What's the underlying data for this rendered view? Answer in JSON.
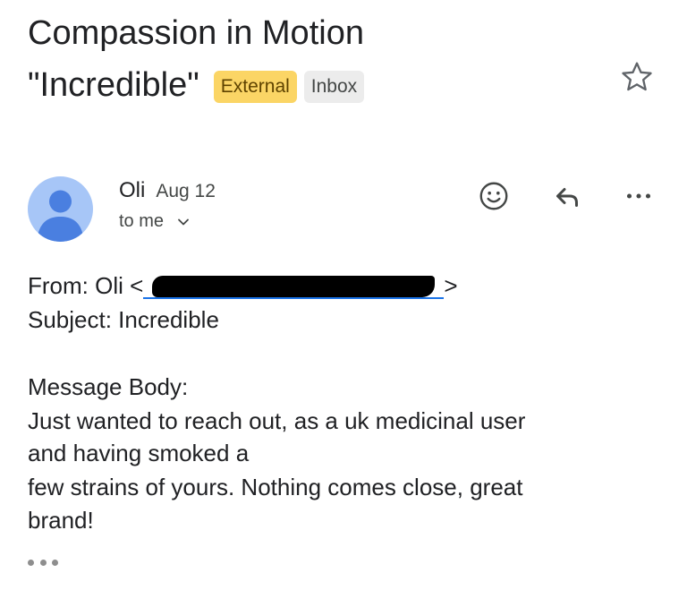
{
  "email": {
    "subject_line1": "Compassion in Motion",
    "subject_line2": "\"Incredible\"",
    "labels": {
      "external": "External",
      "inbox": "Inbox"
    }
  },
  "sender": {
    "name": "Oli",
    "date": "Aug 12",
    "recipient": "to me"
  },
  "body": {
    "from_label": "From: Oli",
    "from_open": "<",
    "from_close": ">",
    "subject": "Subject: Incredible",
    "message_label": "Message Body:",
    "line1": "Just wanted to reach out, as a uk medicinal user",
    "line2": "and having smoked a",
    "line3": "few strains of yours. Nothing comes close, great",
    "line4": "brand!"
  },
  "icons": {
    "star": "star-icon",
    "emoji": "smiley-icon",
    "reply": "reply-icon",
    "more": "more-horizontal-icon",
    "expand": "chevron-down-icon",
    "trimmed": "trimmed-content-icon"
  },
  "colors": {
    "external_badge": "#fbd565",
    "inbox_badge": "#ececec",
    "avatar_bg": "#a7c6f7",
    "avatar_fg": "#4a7fe0",
    "link": "#1a73e8"
  }
}
